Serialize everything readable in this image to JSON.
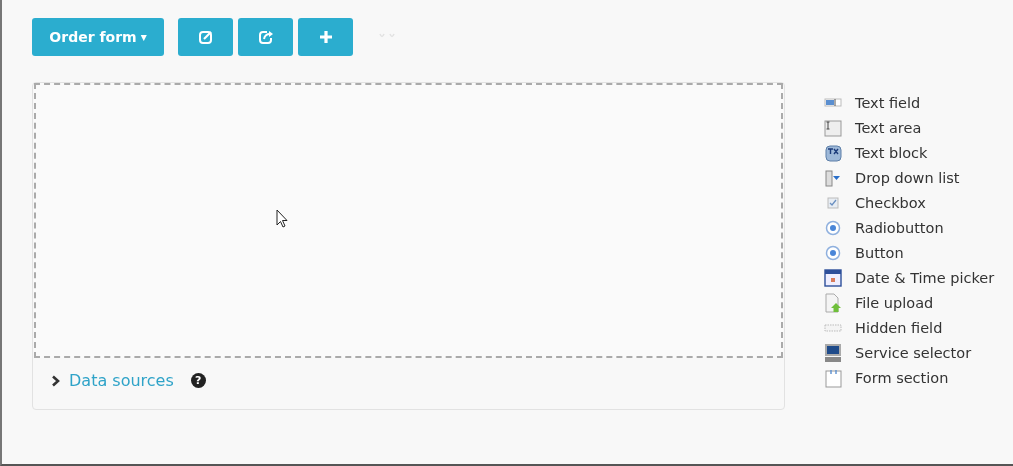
{
  "toolbar": {
    "form_menu": {
      "label": "Order form",
      "caret": "▾"
    },
    "actions": [
      {
        "kind": "edit"
      },
      {
        "kind": "share"
      },
      {
        "kind": "add"
      }
    ]
  },
  "data_sources": {
    "label": "Data sources",
    "expanded": false,
    "help": "?"
  },
  "palette": [
    {
      "kind": "textfield",
      "label": "Text field"
    },
    {
      "kind": "textarea",
      "label": "Text area"
    },
    {
      "kind": "textblock",
      "label": "Text block"
    },
    {
      "kind": "dropdown",
      "label": "Drop down list"
    },
    {
      "kind": "checkbox",
      "label": "Checkbox"
    },
    {
      "kind": "radio",
      "label": "Radiobutton"
    },
    {
      "kind": "radio",
      "label": "Button"
    },
    {
      "kind": "datetime",
      "label": "Date & Time picker"
    },
    {
      "kind": "file",
      "label": "File upload"
    },
    {
      "kind": "hidden",
      "label": "Hidden field"
    },
    {
      "kind": "service",
      "label": "Service selector"
    },
    {
      "kind": "section",
      "label": "Form section"
    }
  ]
}
